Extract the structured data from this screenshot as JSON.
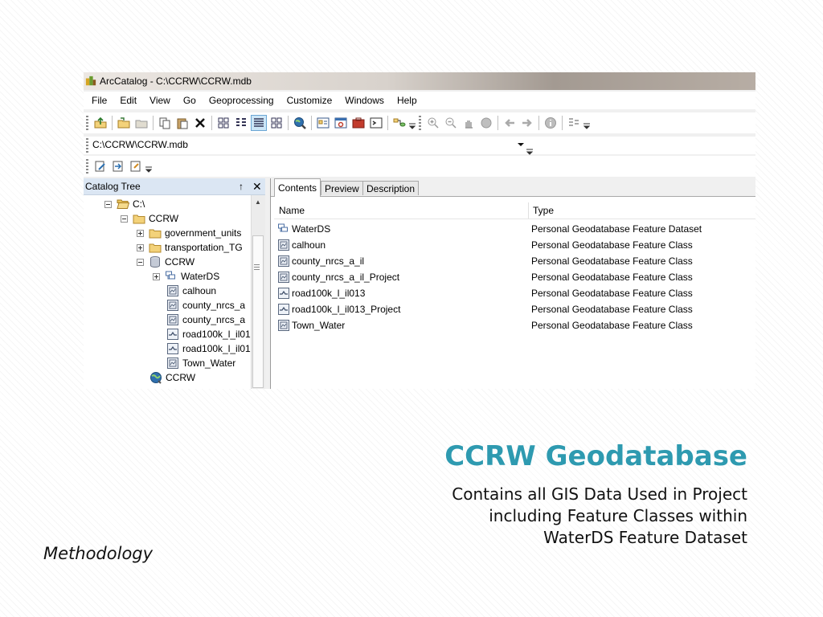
{
  "window": {
    "title": "ArcCatalog - C:\\CCRW\\CCRW.mdb"
  },
  "menu": [
    "File",
    "Edit",
    "View",
    "Go",
    "Geoprocessing",
    "Customize",
    "Windows",
    "Help"
  ],
  "address": {
    "value": "C:\\CCRW\\CCRW.mdb"
  },
  "catalog_tree": {
    "header": "Catalog Tree",
    "pin_glyph": "↑",
    "close_glyph": "✕",
    "items": [
      {
        "label": "C:\\",
        "icon": "open-folder-icon"
      },
      {
        "label": "CCRW",
        "icon": "folder-icon"
      },
      {
        "label": "government_units",
        "icon": "folder-icon"
      },
      {
        "label": "transportation_TG",
        "icon": "folder-icon"
      },
      {
        "label": "CCRW",
        "icon": "geodatabase-icon"
      },
      {
        "label": "WaterDS",
        "icon": "feature-dataset-icon"
      },
      {
        "label": "calhoun",
        "icon": "polygon-feature-class-icon"
      },
      {
        "label": "county_nrcs_a",
        "icon": "polygon-feature-class-icon"
      },
      {
        "label": "county_nrcs_a",
        "icon": "polygon-feature-class-icon"
      },
      {
        "label": "road100k_l_il01",
        "icon": "line-feature-class-icon"
      },
      {
        "label": "road100k_l_il01",
        "icon": "line-feature-class-icon"
      },
      {
        "label": "Town_Water",
        "icon": "polygon-feature-class-icon"
      },
      {
        "label": "CCRW",
        "icon": "globe-icon"
      }
    ]
  },
  "tabs": [
    "Contents",
    "Preview",
    "Description"
  ],
  "contents": {
    "columns": [
      "Name",
      "Type"
    ],
    "rows": [
      {
        "name": "WaterDS",
        "type": "Personal Geodatabase Feature Dataset",
        "icon": "feature-dataset-icon"
      },
      {
        "name": "calhoun",
        "type": "Personal Geodatabase Feature Class",
        "icon": "polygon-feature-class-icon"
      },
      {
        "name": "county_nrcs_a_il",
        "type": "Personal Geodatabase Feature Class",
        "icon": "polygon-feature-class-icon"
      },
      {
        "name": "county_nrcs_a_il_Project",
        "type": "Personal Geodatabase Feature Class",
        "icon": "polygon-feature-class-icon"
      },
      {
        "name": "road100k_l_il013",
        "type": "Personal Geodatabase Feature Class",
        "icon": "line-feature-class-icon"
      },
      {
        "name": "road100k_l_il013_Project",
        "type": "Personal Geodatabase Feature Class",
        "icon": "line-feature-class-icon"
      },
      {
        "name": "Town_Water",
        "type": "Personal Geodatabase Feature Class",
        "icon": "polygon-feature-class-icon"
      }
    ]
  },
  "slide": {
    "title": "CCRW Geodatabase",
    "body_lines": [
      "Contains all GIS Data Used in Project",
      "including Feature Classes within",
      "WaterDS Feature Dataset"
    ],
    "footer": "Methodology"
  },
  "colors": {
    "title_accent": "#2e9ab0",
    "panel_header": "#dbe6f3",
    "active_button": "#cde6f7"
  }
}
